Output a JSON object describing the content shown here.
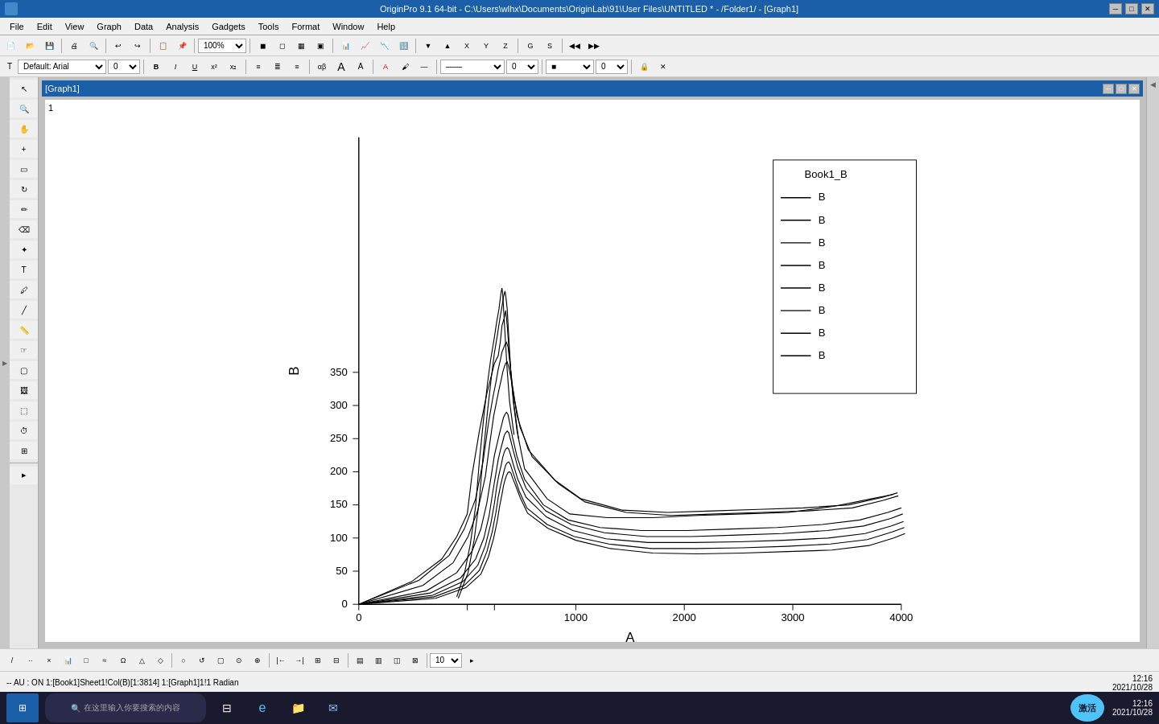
{
  "titlebar": {
    "title": "OriginPro 9.1 64-bit - C:\\Users\\wlhx\\Documents\\OriginLab\\91\\User Files\\UNTITLED * - /Folder1/ - [Graph1]",
    "minimize": "─",
    "maximize": "□",
    "close": "✕"
  },
  "menubar": {
    "items": [
      "File",
      "Edit",
      "View",
      "Graph",
      "Data",
      "Analysis",
      "Gadgets",
      "Tools",
      "Format",
      "Window",
      "Help"
    ]
  },
  "graph": {
    "title": "[Graph1]",
    "page_number": "1",
    "x_axis_label": "A",
    "y_axis_label": "B",
    "x_ticks": [
      "0",
      "1000",
      "2000",
      "3000",
      "4000"
    ],
    "y_ticks": [
      "0",
      "50",
      "100",
      "150",
      "200",
      "250",
      "300",
      "350"
    ]
  },
  "legend": {
    "title": "Book1_B",
    "items": [
      "B",
      "B",
      "B",
      "B",
      "B",
      "B",
      "B",
      "B"
    ]
  },
  "statusbar": {
    "left": "-- AU : ON   1:[Book1]Sheet1!Col(B)[1:3814]  1:[Graph1]1!1  Radian",
    "clock": "12:16",
    "date": "2021/10/28"
  },
  "zoom": "100%",
  "font_name": "Default: Arial",
  "font_size": "0",
  "toolbar": {
    "bottom_size": "10"
  }
}
